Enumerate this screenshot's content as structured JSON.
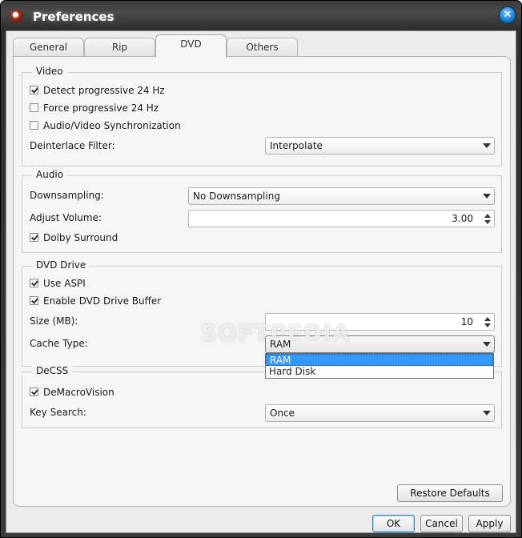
{
  "window": {
    "title": "Preferences"
  },
  "tabs": [
    {
      "label": "General"
    },
    {
      "label": "Rip"
    },
    {
      "label": "DVD",
      "active": true
    },
    {
      "label": "Others"
    }
  ],
  "video": {
    "group_title": "Video",
    "detect_progressive": {
      "label": "Detect progressive 24 Hz",
      "checked": true
    },
    "force_progressive": {
      "label": "Force progressive 24 Hz",
      "checked": false
    },
    "av_sync": {
      "label": "Audio/Video Synchronization",
      "checked": false
    },
    "deinterlace_label": "Deinterlace Filter:",
    "deinterlace_value": "Interpolate"
  },
  "audio": {
    "group_title": "Audio",
    "downsampling_label": "Downsampling:",
    "downsampling_value": "No Downsampling",
    "adjust_volume_label": "Adjust Volume:",
    "adjust_volume_value": "3.00",
    "dolby": {
      "label": "Dolby Surround",
      "checked": true
    }
  },
  "dvd_drive": {
    "group_title": "DVD Drive",
    "use_aspi": {
      "label": "Use ASPI",
      "checked": true
    },
    "enable_buffer": {
      "label": "Enable DVD Drive Buffer",
      "checked": true
    },
    "size_label": "Size (MB):",
    "size_value": "10",
    "cache_type_label": "Cache Type:",
    "cache_type_value": "RAM",
    "cache_type_options": [
      "RAM",
      "Hard Disk"
    ]
  },
  "decss": {
    "group_title": "DeCSS",
    "demacrovision": {
      "label": "DeMacroVision",
      "checked": true
    },
    "key_search_label": "Key Search:",
    "key_search_value": "Once"
  },
  "buttons": {
    "restore_defaults": "Restore Defaults",
    "ok": "OK",
    "cancel": "Cancel",
    "apply": "Apply"
  },
  "watermark": "SOFTPEDIA",
  "icons": {
    "app": "app-icon",
    "close": "close-icon"
  }
}
